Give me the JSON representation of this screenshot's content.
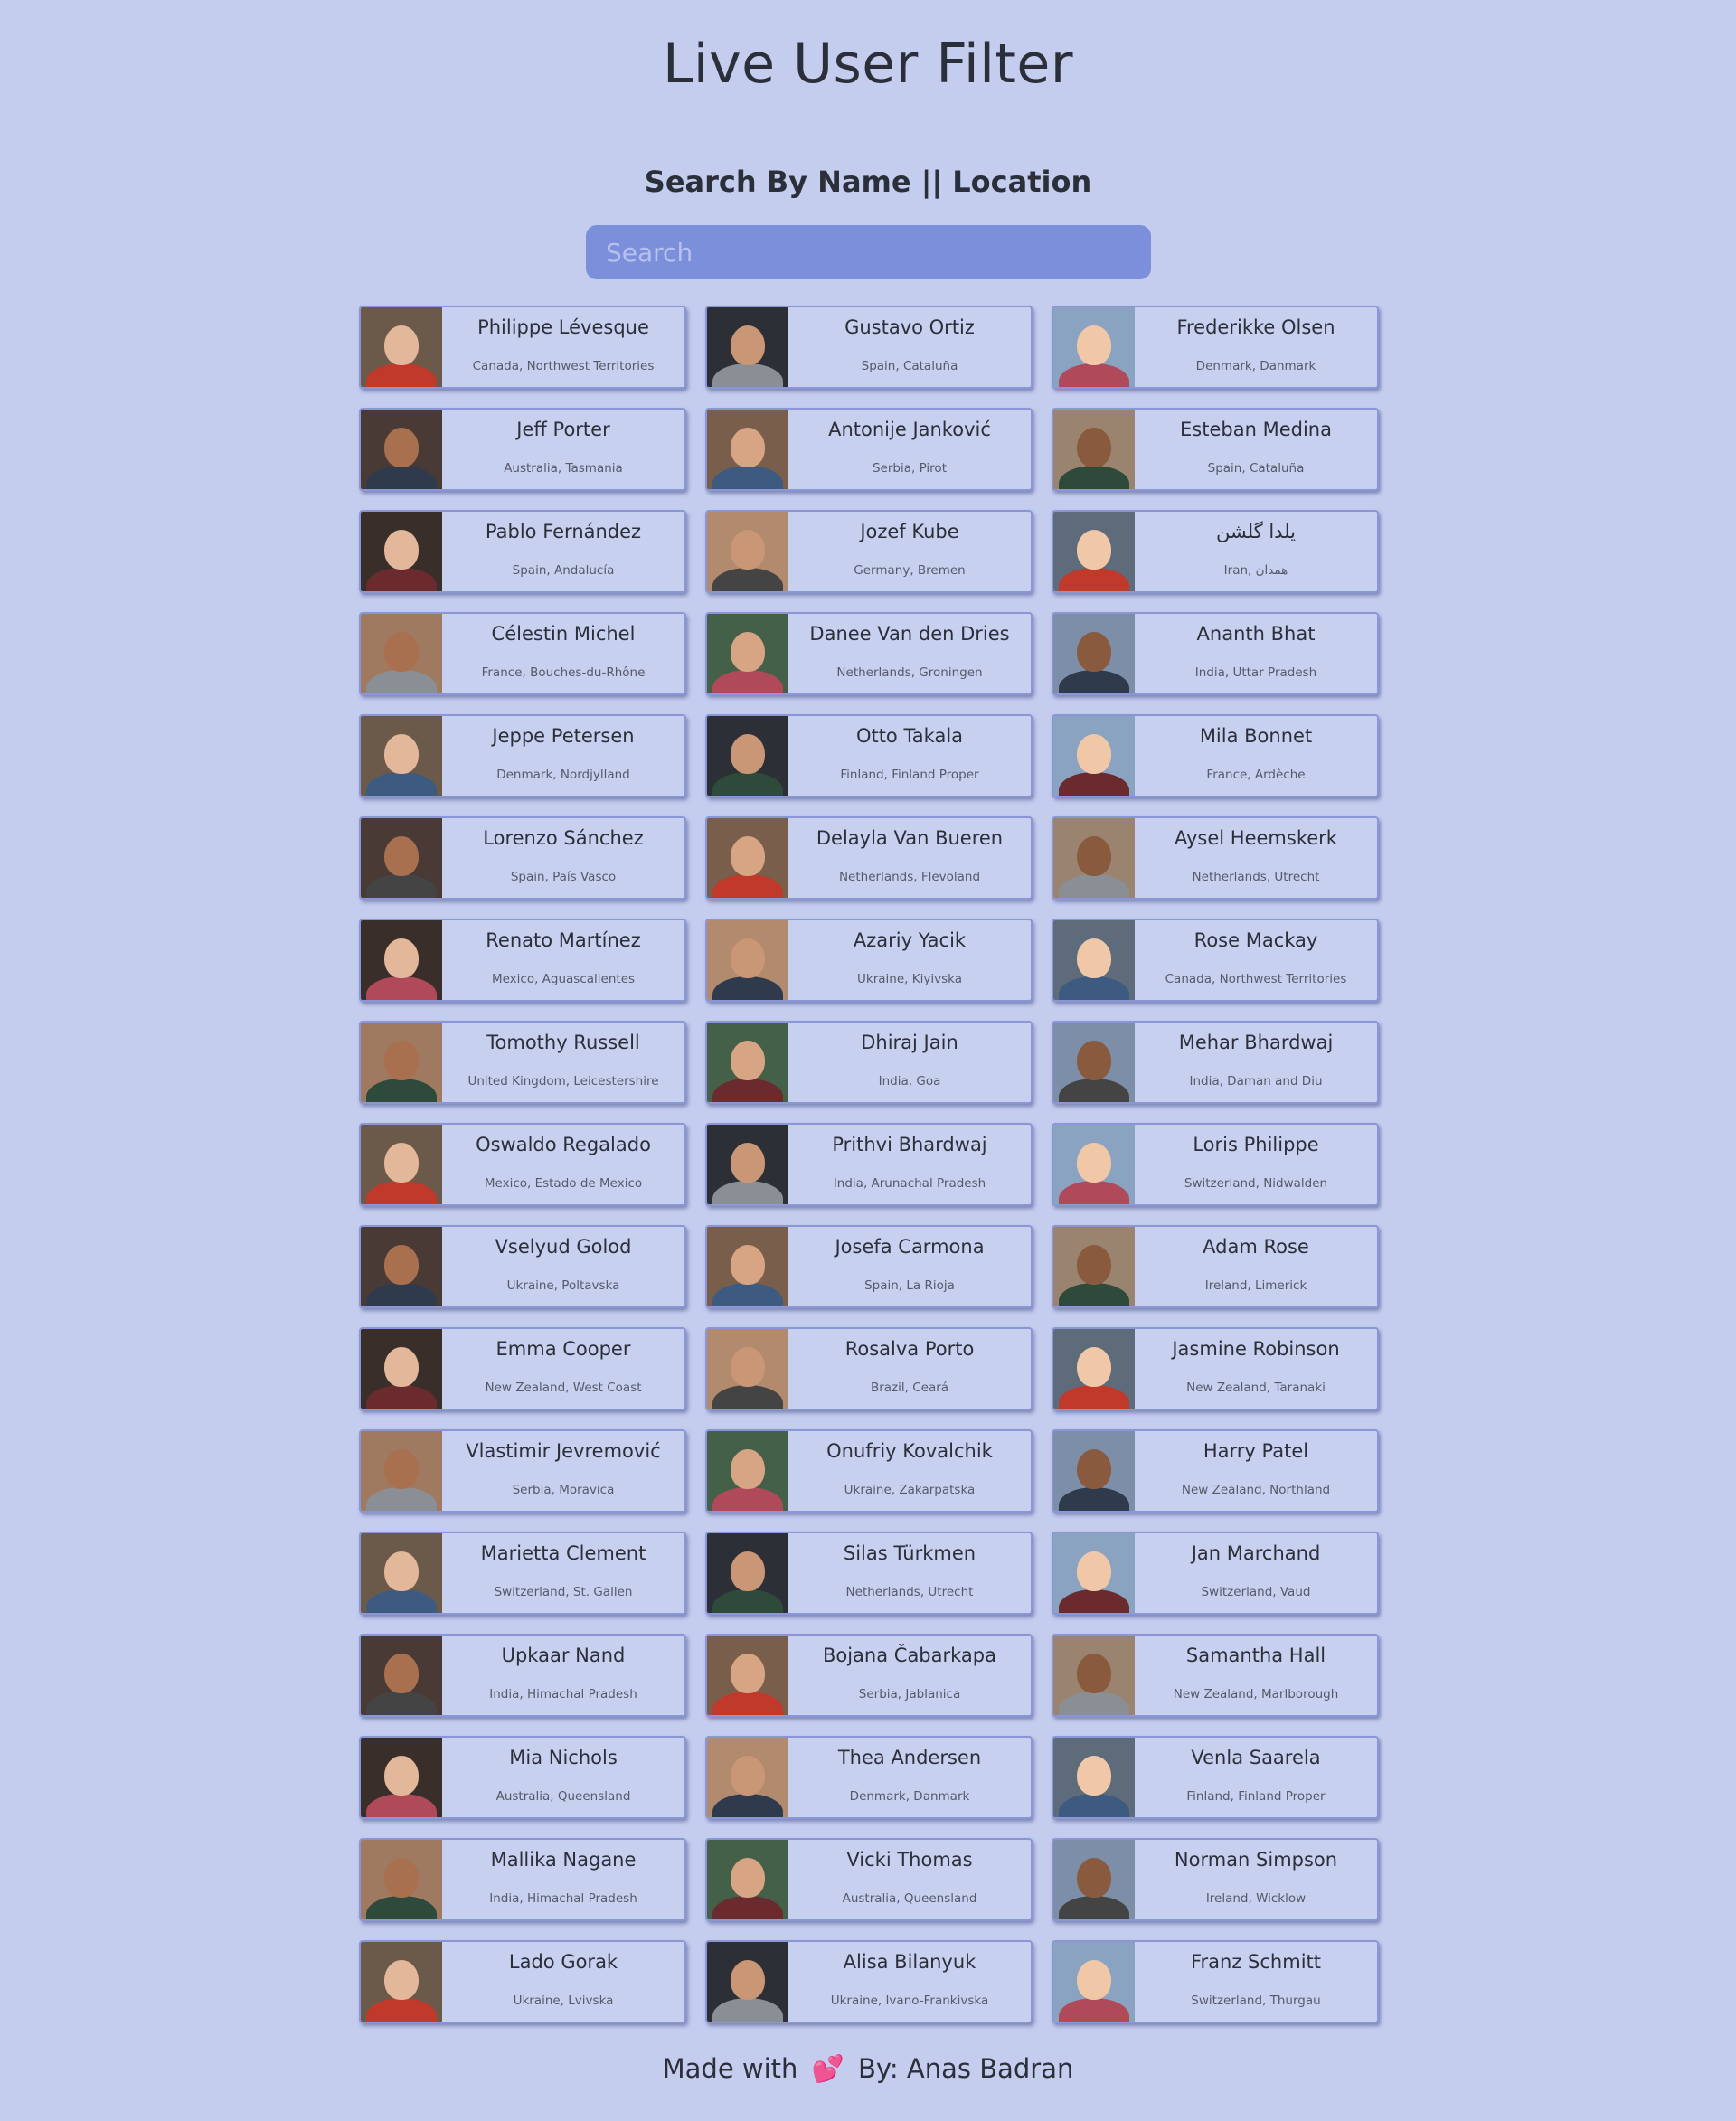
{
  "title": "Live User Filter",
  "search": {
    "label": "Search By Name || Location",
    "placeholder": "Search"
  },
  "footer": {
    "made_with": "Made with",
    "heart": "💕",
    "by": "By: Anas Badran"
  },
  "colors": {
    "background": "#c5cdef",
    "search_bg": "#7c8fdb",
    "card_border": "#8a96d6"
  },
  "users": [
    {
      "name": "Philippe Lévesque",
      "location": "Canada, Northwest Territories"
    },
    {
      "name": "Gustavo Ortiz",
      "location": "Spain, Cataluña"
    },
    {
      "name": "Frederikke Olsen",
      "location": "Denmark, Danmark"
    },
    {
      "name": "Jeff Porter",
      "location": "Australia, Tasmania"
    },
    {
      "name": "Antonije Janković",
      "location": "Serbia, Pirot"
    },
    {
      "name": "Esteban Medina",
      "location": "Spain, Cataluña"
    },
    {
      "name": "Pablo Fernández",
      "location": "Spain, Andalucía"
    },
    {
      "name": "Jozef Kube",
      "location": "Germany, Bremen"
    },
    {
      "name": "یلدا گلشن",
      "location": "Iran, همدان"
    },
    {
      "name": "Célestin Michel",
      "location": "France, Bouches-du-Rhône"
    },
    {
      "name": "Danee Van den Dries",
      "location": "Netherlands, Groningen"
    },
    {
      "name": "Ananth Bhat",
      "location": "India, Uttar Pradesh"
    },
    {
      "name": "Jeppe Petersen",
      "location": "Denmark, Nordjylland"
    },
    {
      "name": "Otto Takala",
      "location": "Finland, Finland Proper"
    },
    {
      "name": "Mila Bonnet",
      "location": "France, Ardèche"
    },
    {
      "name": "Lorenzo Sánchez",
      "location": "Spain, País Vasco"
    },
    {
      "name": "Delayla Van Bueren",
      "location": "Netherlands, Flevoland"
    },
    {
      "name": "Aysel Heemskerk",
      "location": "Netherlands, Utrecht"
    },
    {
      "name": "Renato Martínez",
      "location": "Mexico, Aguascalientes"
    },
    {
      "name": "Azariy Yacik",
      "location": "Ukraine, Kiyivska"
    },
    {
      "name": "Rose Mackay",
      "location": "Canada, Northwest Territories"
    },
    {
      "name": "Tomothy Russell",
      "location": "United Kingdom, Leicestershire"
    },
    {
      "name": "Dhiraj Jain",
      "location": "India, Goa"
    },
    {
      "name": "Mehar Bhardwaj",
      "location": "India, Daman and Diu"
    },
    {
      "name": "Oswaldo Regalado",
      "location": "Mexico, Estado de Mexico"
    },
    {
      "name": "Prithvi Bhardwaj",
      "location": "India, Arunachal Pradesh"
    },
    {
      "name": "Loris Philippe",
      "location": "Switzerland, Nidwalden"
    },
    {
      "name": "Vselyud Golod",
      "location": "Ukraine, Poltavska"
    },
    {
      "name": "Josefa Carmona",
      "location": "Spain, La Rioja"
    },
    {
      "name": "Adam Rose",
      "location": "Ireland, Limerick"
    },
    {
      "name": "Emma Cooper",
      "location": "New Zealand, West Coast"
    },
    {
      "name": "Rosalva Porto",
      "location": "Brazil, Ceará"
    },
    {
      "name": "Jasmine Robinson",
      "location": "New Zealand, Taranaki"
    },
    {
      "name": "Vlastimir Jevremović",
      "location": "Serbia, Moravica"
    },
    {
      "name": "Onufriy Kovalchik",
      "location": "Ukraine, Zakarpatska"
    },
    {
      "name": "Harry Patel",
      "location": "New Zealand, Northland"
    },
    {
      "name": "Marietta Clement",
      "location": "Switzerland, St. Gallen"
    },
    {
      "name": "Silas Türkmen",
      "location": "Netherlands, Utrecht"
    },
    {
      "name": "Jan Marchand",
      "location": "Switzerland, Vaud"
    },
    {
      "name": "Upkaar Nand",
      "location": "India, Himachal Pradesh"
    },
    {
      "name": "Bojana Čabarkapa",
      "location": "Serbia, Jablanica"
    },
    {
      "name": "Samantha Hall",
      "location": "New Zealand, Marlborough"
    },
    {
      "name": "Mia Nichols",
      "location": "Australia, Queensland"
    },
    {
      "name": "Thea Andersen",
      "location": "Denmark, Danmark"
    },
    {
      "name": "Venla Saarela",
      "location": "Finland, Finland Proper"
    },
    {
      "name": "Mallika Nagane",
      "location": "India, Himachal Pradesh"
    },
    {
      "name": "Vicki Thomas",
      "location": "Australia, Queensland"
    },
    {
      "name": "Norman Simpson",
      "location": "Ireland, Wicklow"
    },
    {
      "name": "Lado Gorak",
      "location": "Ukraine, Lvivska"
    },
    {
      "name": "Alisa Bilanyuk",
      "location": "Ukraine, Ivano-Frankivska"
    },
    {
      "name": "Franz Schmitt",
      "location": "Switzerland, Thurgau"
    }
  ]
}
